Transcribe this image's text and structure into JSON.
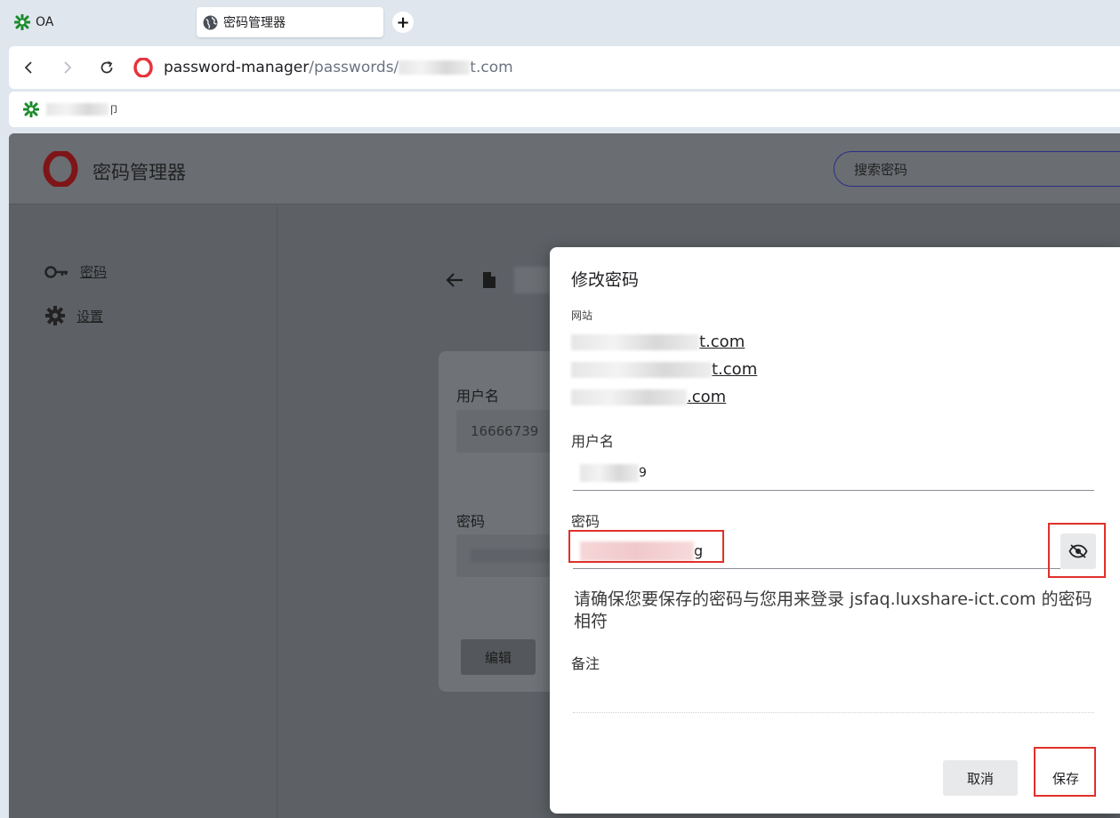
{
  "tabs": [
    {
      "label": "OA",
      "icon": "oa-snowflake-icon",
      "active": false
    },
    {
      "label": "密码管理器",
      "icon": "globe-icon",
      "active": true
    }
  ],
  "new_tab_symbol": "+",
  "address": {
    "host": "password-manager",
    "path": "/passwords/",
    "suffix": "t.com"
  },
  "bookmark": {
    "icon": "oa-snowflake-icon",
    "label_visible": "卩"
  },
  "app": {
    "title": "密码管理器",
    "search_placeholder": "搜索密码",
    "brand_color": "#d1141f"
  },
  "sidebar": {
    "items": [
      {
        "label": "密码",
        "icon": "key-icon"
      },
      {
        "label": "设置",
        "icon": "gear-icon"
      }
    ]
  },
  "detail_card": {
    "username_label": "用户名",
    "username_value": "16666739",
    "password_label": "密码",
    "edit_label": "编辑"
  },
  "modal": {
    "title": "修改密码",
    "websites_label": "网站",
    "websites": [
      {
        "visible_suffix": "t.com"
      },
      {
        "visible_suffix": "t.com"
      },
      {
        "visible_suffix": ".com"
      }
    ],
    "username_label": "用户名",
    "username_visible": "9",
    "password_label": "密码",
    "password_visible": "g",
    "warning": "请确保您要保存的密码与您用来登录 jsfaq.luxshare-ict.com 的密码相符",
    "notes_label": "备注",
    "cancel_label": "取消",
    "save_label": "保存",
    "highlight_color": "#e0302a"
  }
}
